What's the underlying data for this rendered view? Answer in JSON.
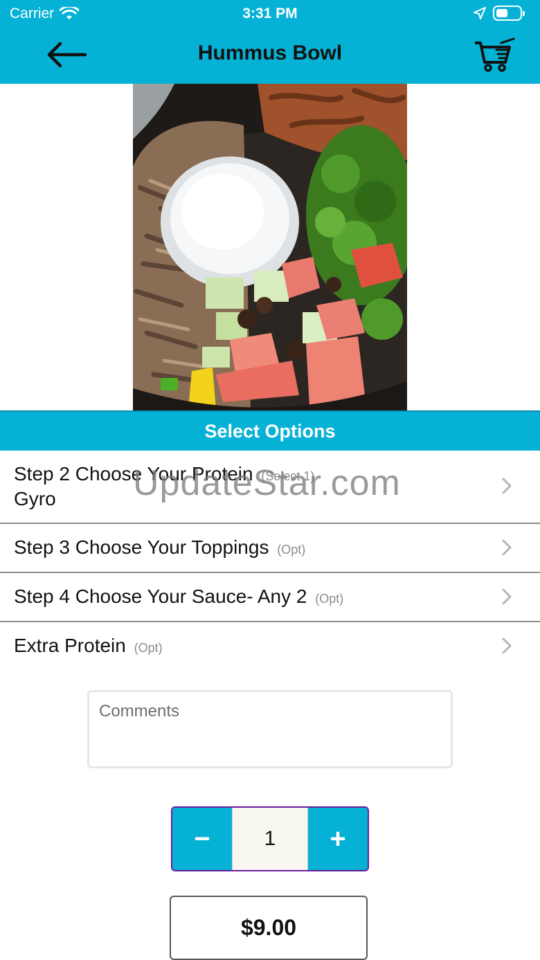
{
  "status_bar": {
    "carrier": "Carrier",
    "time": "3:31 PM"
  },
  "nav": {
    "title": "Hummus Bowl"
  },
  "section": {
    "title": "Select Options"
  },
  "options": [
    {
      "label": "Step 2 Choose Your Protein",
      "tag": "(Select 1)",
      "selection": "Gyro"
    },
    {
      "label": "Step 3 Choose Your Toppings",
      "tag": "(Opt)"
    },
    {
      "label": "Step 4 Choose Your Sauce- Any 2",
      "tag": "(Opt)"
    },
    {
      "label": "Extra Protein",
      "tag": "(Opt)"
    }
  ],
  "watermark": "UpdateStar.com",
  "comments": {
    "placeholder": "Comments"
  },
  "quantity": {
    "minus": "−",
    "value": "1",
    "plus": "+"
  },
  "price": "$9.00",
  "colors": {
    "accent": "#05b2d6",
    "stepper_border": "#6a1b9a"
  }
}
